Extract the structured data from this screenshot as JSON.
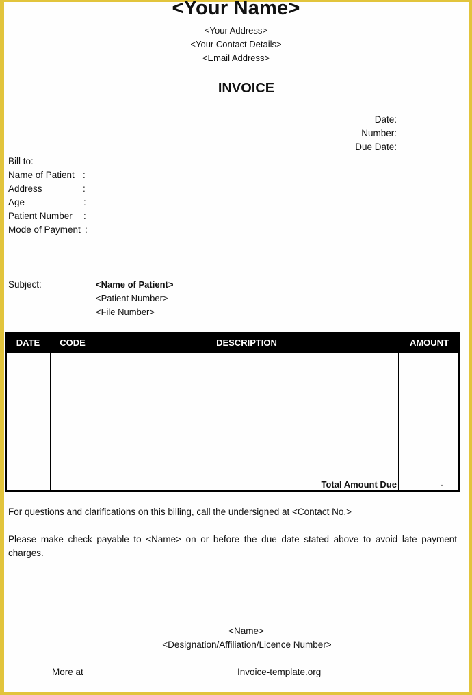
{
  "header": {
    "name": "<Your Name>",
    "address": "<Your Address>",
    "contact": "<Your Contact Details>",
    "email": "<Email Address>",
    "title": "INVOICE"
  },
  "meta": {
    "date_label": "Date:",
    "number_label": "Number:",
    "due_date_label": "Due Date:"
  },
  "bill_to": {
    "heading": "Bill to:",
    "fields": [
      {
        "label": "Name of Patient",
        "colon": ":"
      },
      {
        "label": "Address",
        "colon": ":"
      },
      {
        "label": "Age",
        "colon": ":"
      },
      {
        "label": "Patient Number",
        "colon": ":"
      },
      {
        "label": "Mode of Payment",
        "colon": ":"
      }
    ]
  },
  "subject": {
    "label": "Subject:",
    "patient_name": "<Name of Patient>",
    "patient_number": "<Patient Number>",
    "file_number": "<File Number>"
  },
  "table": {
    "columns": [
      "DATE",
      "CODE",
      "DESCRIPTION",
      "AMOUNT"
    ],
    "rows": [],
    "total_label": "Total Amount Due",
    "total_value": "-"
  },
  "notes": {
    "questions": "For questions and clarifications on this billing, call the undersigned at <Contact No.>",
    "payable": "Please make check payable to <Name> on or before the due date stated above to avoid late payment charges."
  },
  "signature": {
    "name": "<Name>",
    "designation": "<Designation/Affiliation/Licence Number>"
  },
  "footer": {
    "more_at": "More at",
    "site": "Invoice-template.org"
  },
  "colors": {
    "frame": "#e2c43c",
    "table_header_bg": "#000000",
    "table_header_text": "#ffffff"
  }
}
